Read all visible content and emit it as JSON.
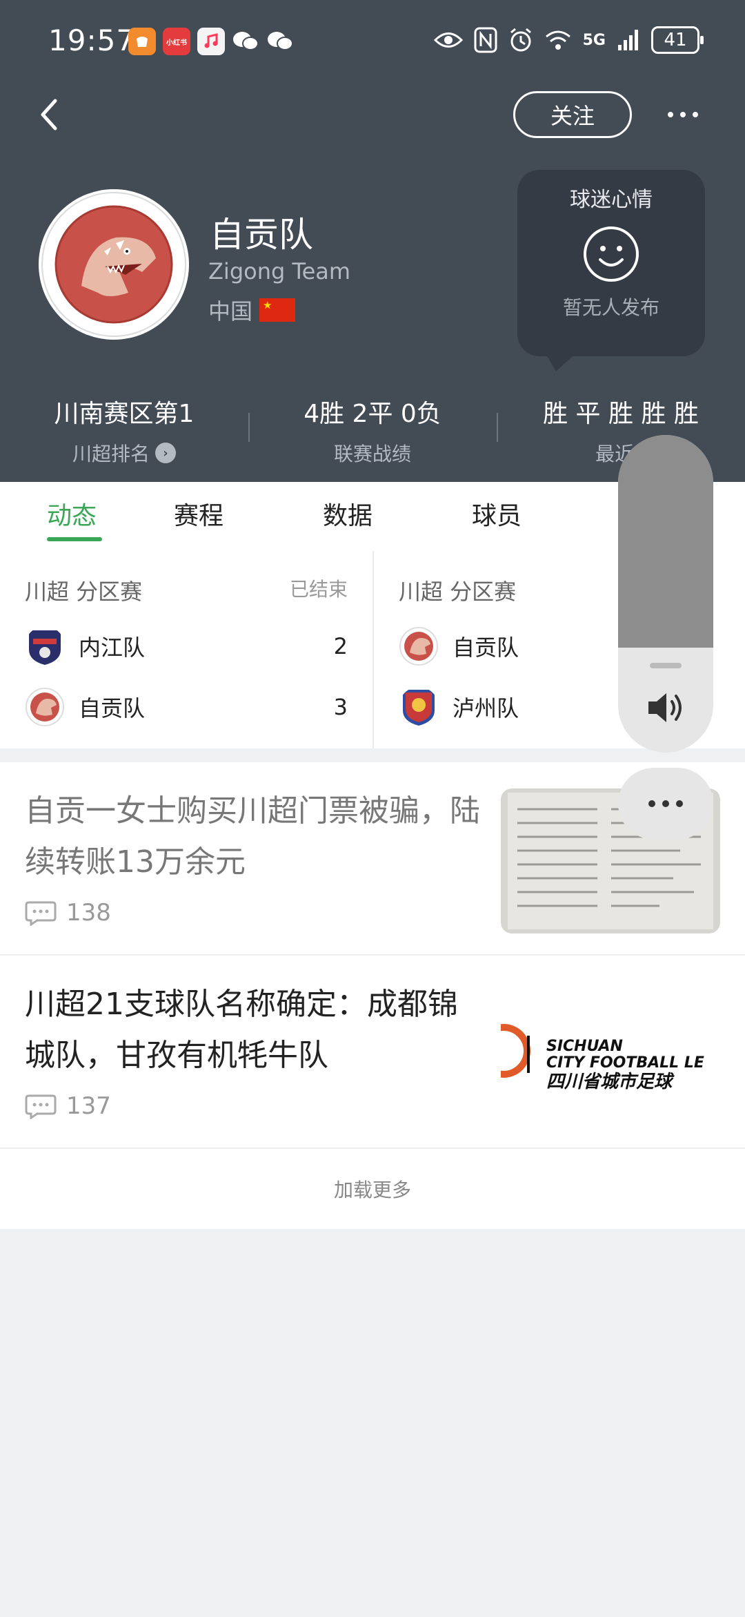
{
  "status_bar": {
    "time": "19:57",
    "apps": [
      "taobao-icon",
      "xiaohongshu-icon",
      "music-icon",
      "wechat-icon",
      "wechat-icon"
    ],
    "xhs_text": "小红书",
    "signal_label": "5G",
    "battery": "41"
  },
  "header": {
    "follow_label": "关注",
    "team_name": "自贡队",
    "team_en": "Zigong Team",
    "country": "中国",
    "mood": {
      "title": "球迷心情",
      "empty": "暂无人发布"
    },
    "stats": [
      {
        "value": "川南赛区第1",
        "label": "川超排名"
      },
      {
        "value": "4胜 2平 0负",
        "label": "联赛战绩"
      },
      {
        "value": "胜 平 胜 胜 胜",
        "label": "最近5"
      }
    ]
  },
  "tabs": [
    "动态",
    "赛程",
    "数据",
    "球员"
  ],
  "matches": [
    {
      "league": "川超 分区赛",
      "status": "已结束",
      "teams": [
        {
          "name": "内江队",
          "score": "2"
        },
        {
          "name": "自贡队",
          "score": "3"
        }
      ]
    },
    {
      "league": "川超 分区赛",
      "status": "",
      "teams": [
        {
          "name": "自贡队",
          "score": ""
        },
        {
          "name": "泸州队",
          "score": ""
        }
      ]
    }
  ],
  "news": [
    {
      "title": "自贡一女士购买川超门票被骗，陆续转账13万余元",
      "comments": "138"
    },
    {
      "title": "川超21支球队名称确定：成都锦城队，甘孜有机牦牛队",
      "comments": "137"
    }
  ],
  "thumb2_text": {
    "line1": "SICHUAN",
    "line2": "CITY FOOTBALL LE",
    "line3": "四川省城市足球"
  },
  "load_more": "加载更多",
  "colors": {
    "header_bg": "#434b55",
    "accent_green": "#3aa757",
    "flag_red": "#de2910"
  },
  "volume_level": 0.67
}
